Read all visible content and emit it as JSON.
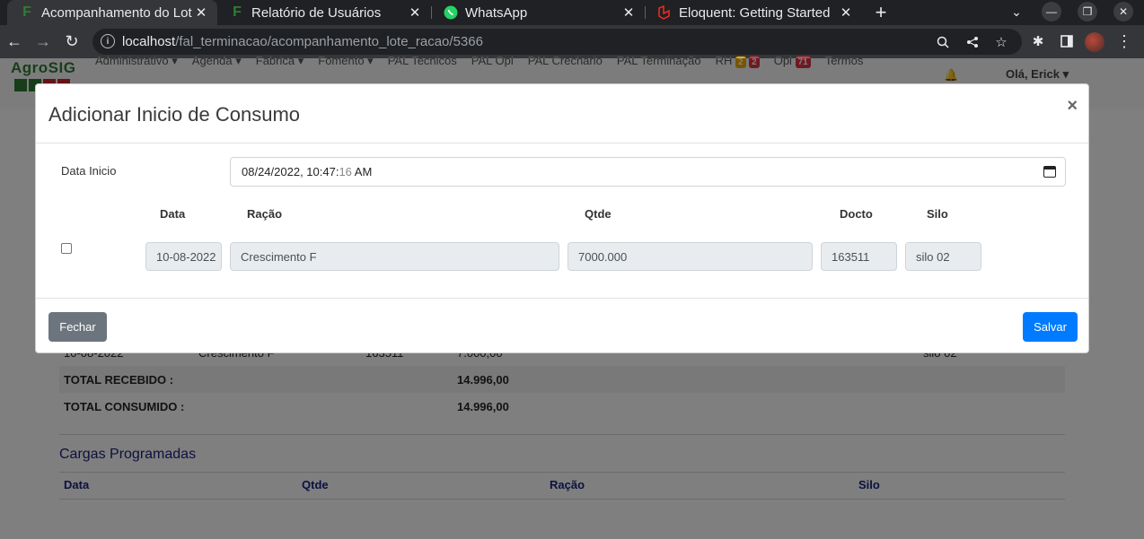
{
  "browser": {
    "tabs": [
      {
        "title": "Acompanhamento do Lot",
        "favicon": "F",
        "active": true
      },
      {
        "title": "Relatório de Usuários",
        "favicon": "F",
        "active": false
      },
      {
        "title": "WhatsApp",
        "favicon": "whatsapp-icon",
        "active": false
      },
      {
        "title": "Eloquent: Getting Started",
        "favicon": "laravel-icon",
        "active": false
      }
    ],
    "url_host": "localhost",
    "url_path": "/fal_terminacao/acompanhamento_lote_racao/5366"
  },
  "navbar": {
    "logo": "AgroSIG",
    "items": [
      "Administrativo",
      "Agenda",
      "Fabrica",
      "Fomento",
      "PAL Tecnicos",
      "PAL Opl",
      "PAL Crechario",
      "PAL Terminação"
    ],
    "rh_label": "RH",
    "rh_badges": [
      "2",
      "2"
    ],
    "opl_label": "Opl",
    "opl_badge": "71",
    "termos": "Termos",
    "greeting": "Olá, Erick"
  },
  "background": {
    "row": {
      "data": "10-08-2022",
      "racao": "Crescimento F",
      "docto": "163511",
      "qtde": "7.000,00",
      "silo": "silo 02"
    },
    "total_recebido_label": "TOTAL RECEBIDO :",
    "total_recebido_value": "14.996,00",
    "total_consumido_label": "TOTAL CONSUMIDO :",
    "total_consumido_value": "14.996,00",
    "section_title": "Cargas Programadas",
    "columns": [
      "Data",
      "Qtde",
      "Ração",
      "Silo"
    ]
  },
  "modal": {
    "title": "Adicionar Inicio de Consumo",
    "close": "×",
    "data_inicio_label": "Data Inicio",
    "datetime_main": "08/24/2022, 10:47:",
    "datetime_sec": "16",
    "datetime_ampm": " AM",
    "table_headers": {
      "data": "Data",
      "racao": "Ração",
      "qtde": "Qtde",
      "docto": "Docto",
      "silo": "Silo"
    },
    "row": {
      "data": "10-08-2022",
      "racao": "Crescimento F",
      "qtde": "7000.000",
      "docto": "163511",
      "silo": "silo 02"
    },
    "close_button": "Fechar",
    "save_button": "Salvar"
  },
  "colors": {
    "primary": "#007bff",
    "secondary": "#6c757d",
    "brand_green": "#2e7d32",
    "heading_navy": "#1a237e"
  }
}
